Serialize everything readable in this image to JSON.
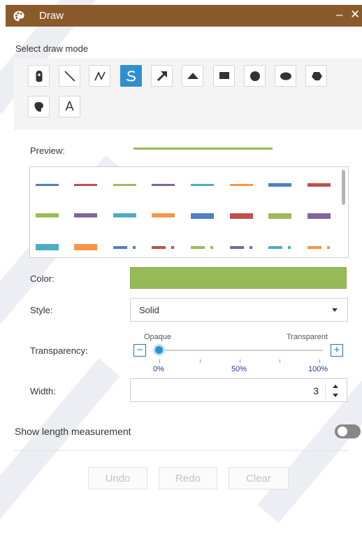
{
  "window": {
    "title": "Draw",
    "minimize_glyph": "–",
    "close_glyph": "✕"
  },
  "draw_mode": {
    "label": "Select draw mode",
    "tools": [
      {
        "id": "point",
        "icon": "map-pin-icon",
        "active": false
      },
      {
        "id": "line",
        "icon": "line-icon",
        "active": false
      },
      {
        "id": "polyline",
        "icon": "polyline-icon",
        "active": false
      },
      {
        "id": "freehand-line",
        "icon": "freehand-line-icon",
        "active": true
      },
      {
        "id": "arrow",
        "icon": "arrow-icon",
        "active": false
      },
      {
        "id": "triangle",
        "icon": "triangle-icon",
        "active": false
      },
      {
        "id": "rectangle",
        "icon": "rectangle-icon",
        "active": false
      },
      {
        "id": "circle",
        "icon": "circle-icon",
        "active": false
      },
      {
        "id": "ellipse",
        "icon": "ellipse-icon",
        "active": false
      },
      {
        "id": "polygon",
        "icon": "polygon-icon",
        "active": false
      },
      {
        "id": "freehand-polygon",
        "icon": "freehand-polygon-icon",
        "active": false
      },
      {
        "id": "text",
        "icon": "text-icon",
        "glyph": "A",
        "active": false
      }
    ]
  },
  "preview": {
    "label": "Preview:"
  },
  "styles": {
    "colors": [
      "#4e80c0",
      "#c0504d",
      "#9bbb59",
      "#8064a2",
      "#4bacc6",
      "#f79646"
    ]
  },
  "color": {
    "label": "Color:",
    "value": "#96ba55"
  },
  "style": {
    "label": "Style:",
    "value": "Solid"
  },
  "transparency": {
    "label": "Transparency:",
    "min_label": "Opaque",
    "max_label": "Transparent",
    "minus_glyph": "−",
    "plus_glyph": "+",
    "value_percent": 0,
    "ticks": [
      "0%",
      "50%",
      "100%"
    ]
  },
  "width": {
    "label": "Width:",
    "value": "3"
  },
  "measurement": {
    "label": "Show length measurement",
    "enabled": false
  },
  "actions": {
    "undo": "Undo",
    "redo": "Redo",
    "clear": "Clear"
  }
}
